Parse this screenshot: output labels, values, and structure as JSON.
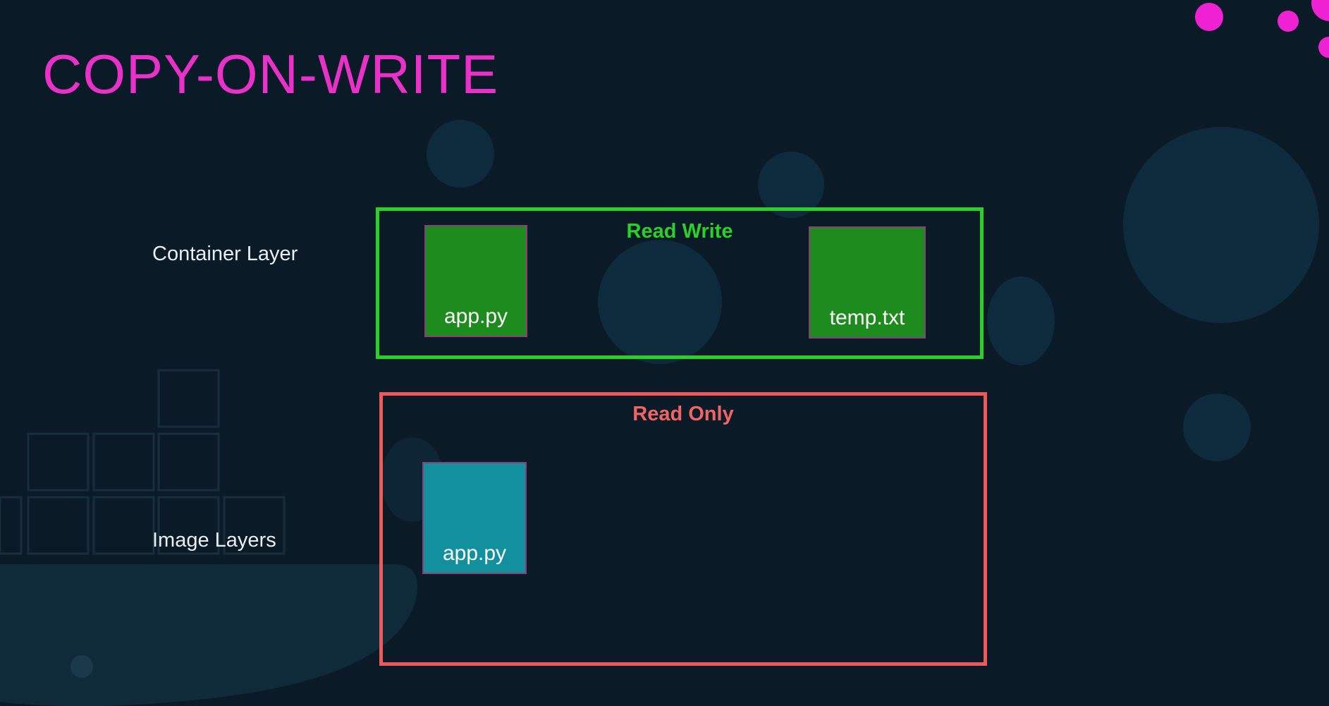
{
  "slide": {
    "title": "COPY-ON-WRITE",
    "colors": {
      "background": "#0a1a26",
      "title": "#e930c8",
      "read_write": "#2ad12a",
      "read_only": "#ee5a5a",
      "file_writable": "#1e8b1e",
      "file_image": "#12909e"
    }
  },
  "labels": {
    "container_layer": "Container Layer",
    "image_layers": "Image Layers"
  },
  "layers": {
    "read_write": {
      "title": "Read Write",
      "files": [
        "app.py",
        "temp.txt"
      ]
    },
    "read_only": {
      "title": "Read Only",
      "files": [
        "app.py"
      ]
    }
  }
}
